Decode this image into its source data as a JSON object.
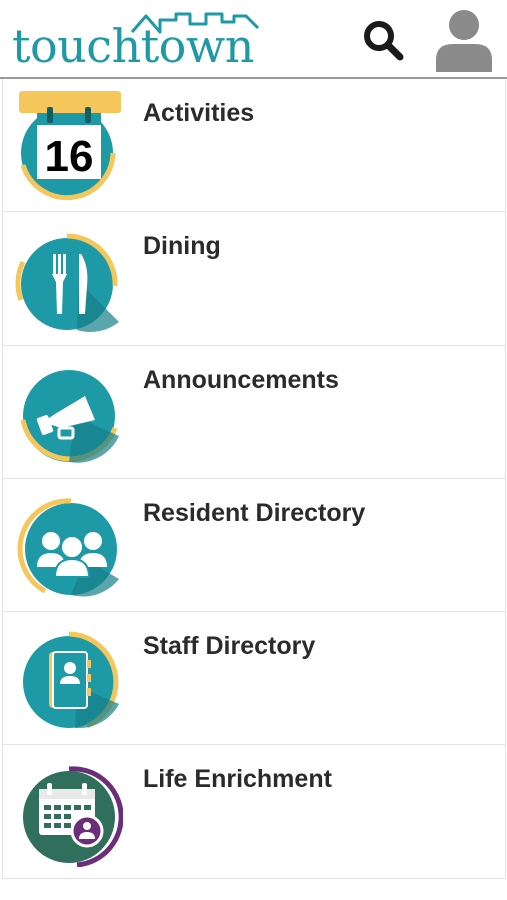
{
  "header": {
    "logo_text": "touchtown",
    "search_icon": "search-icon",
    "profile_icon": "user-avatar-icon"
  },
  "colors": {
    "brand_teal": "#1e9aa6",
    "accent_yellow": "#f5c65a",
    "enrichment_green": "#2f6f5b",
    "enrichment_purple": "#6b2f7a"
  },
  "menu": {
    "items": [
      {
        "label": "Activities",
        "icon": "calendar-16-icon",
        "calendar_day": "16"
      },
      {
        "label": "Dining",
        "icon": "fork-knife-icon"
      },
      {
        "label": "Announcements",
        "icon": "megaphone-icon"
      },
      {
        "label": "Resident Directory",
        "icon": "people-group-icon"
      },
      {
        "label": "Staff Directory",
        "icon": "staff-notebook-icon"
      },
      {
        "label": "Life Enrichment",
        "icon": "calendar-person-icon"
      }
    ]
  }
}
